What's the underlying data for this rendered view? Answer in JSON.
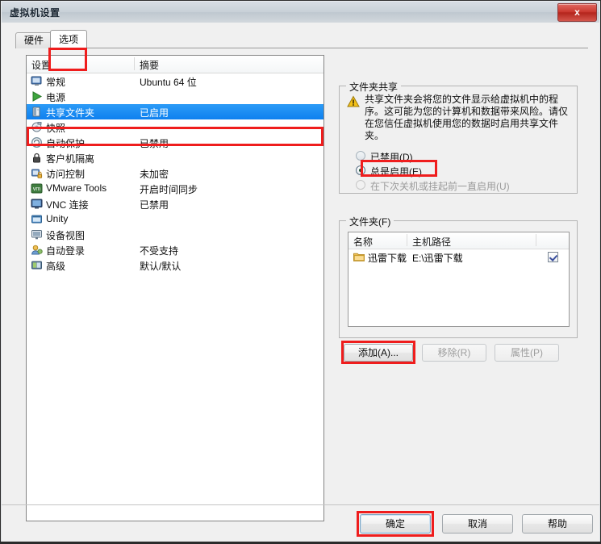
{
  "window": {
    "title": "虚拟机设置",
    "close_label": "x"
  },
  "tabs": [
    {
      "label": "硬件",
      "active": false
    },
    {
      "label": "选项",
      "active": true
    }
  ],
  "settings_list": {
    "columns": [
      "设置",
      "摘要"
    ],
    "rows": [
      {
        "icon": "monitor-icon",
        "label": "常规",
        "summary": "Ubuntu 64 位",
        "selected": false
      },
      {
        "icon": "power-play-icon",
        "label": "电源",
        "summary": "",
        "selected": false
      },
      {
        "icon": "shared-folder-icon",
        "label": "共享文件夹",
        "summary": "已启用",
        "selected": true
      },
      {
        "icon": "snapshot-icon",
        "label": "快照",
        "summary": "",
        "selected": false
      },
      {
        "icon": "autoprotect-icon",
        "label": "自动保护",
        "summary": "已禁用",
        "selected": false
      },
      {
        "icon": "lock-icon",
        "label": "客户机隔离",
        "summary": "",
        "selected": false
      },
      {
        "icon": "access-control-icon",
        "label": "访问控制",
        "summary": "未加密",
        "selected": false
      },
      {
        "icon": "vmware-tools-icon",
        "label": "VMware Tools",
        "summary": "开启时间同步",
        "selected": false
      },
      {
        "icon": "vnc-icon",
        "label": "VNC 连接",
        "summary": "已禁用",
        "selected": false
      },
      {
        "icon": "unity-icon",
        "label": "Unity",
        "summary": "",
        "selected": false
      },
      {
        "icon": "device-view-icon",
        "label": "设备视图",
        "summary": "",
        "selected": false
      },
      {
        "icon": "autologon-icon",
        "label": "自动登录",
        "summary": "不受支持",
        "selected": false
      },
      {
        "icon": "advanced-icon",
        "label": "高级",
        "summary": "默认/默认",
        "selected": false
      }
    ]
  },
  "sharing": {
    "group_title": "文件夹共享",
    "warning_icon": "warning-triangle-icon",
    "warning_text": "共享文件夹会将您的文件显示给虚拟机中的程序。这可能为您的计算机和数据带来风险。请仅在您信任虚拟机使用您的数据时启用共享文件夹。",
    "options": [
      {
        "label": "已禁用(D)",
        "checked": false,
        "disabled": false
      },
      {
        "label": "总是启用(E)",
        "checked": true,
        "disabled": false
      },
      {
        "label": "在下次关机或挂起前一直启用(U)",
        "checked": false,
        "disabled": true
      }
    ]
  },
  "folders": {
    "group_title": "文件夹(F)",
    "columns": [
      "名称",
      "主机路径",
      ""
    ],
    "rows": [
      {
        "icon": "folder-icon",
        "name": "迅雷下载",
        "path": "E:\\迅雷下载",
        "enabled": true
      }
    ],
    "buttons": [
      {
        "label": "添加(A)...",
        "disabled": false
      },
      {
        "label": "移除(R)",
        "disabled": true
      },
      {
        "label": "属性(P)",
        "disabled": true
      }
    ]
  },
  "footer_buttons": [
    {
      "label": "确定",
      "default": true
    },
    {
      "label": "取消",
      "default": false
    },
    {
      "label": "帮助",
      "default": false
    }
  ],
  "colors": {
    "selection_blue": "#0e80ef",
    "annotation_red": "#ef1d1d",
    "close_red": "#cc3a31",
    "warning_yellow": "#f3c018"
  }
}
